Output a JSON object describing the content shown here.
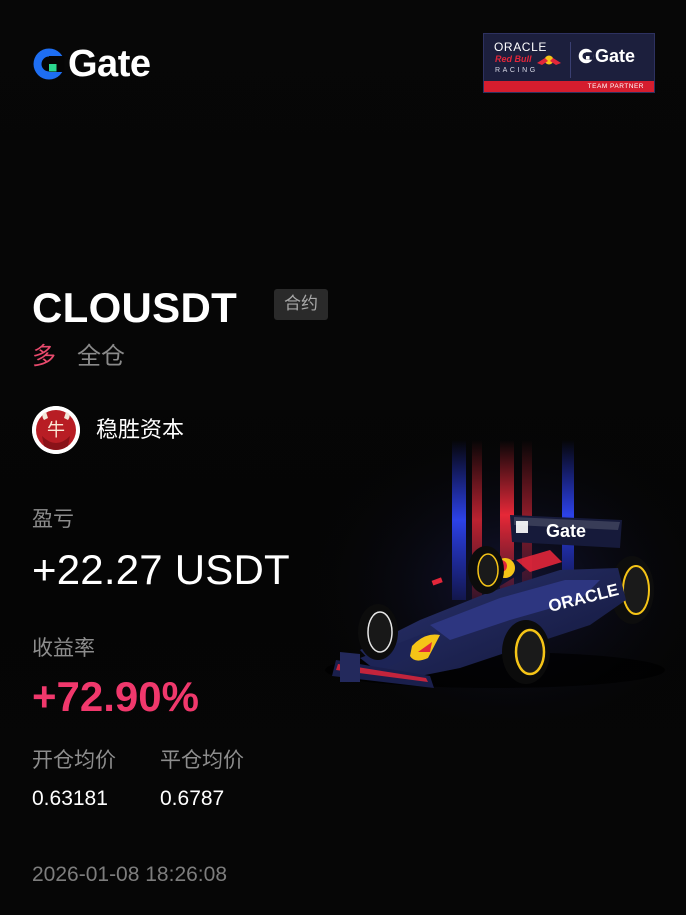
{
  "brand": {
    "logo_text": "Gate",
    "logo_icon": "gate-logo-icon",
    "accent_color": "#1e6ef2"
  },
  "partner_badge": {
    "line1": "ORACLE",
    "line2": "Red Bull",
    "line3": "RACING",
    "partner_logo_text": "Gate",
    "footer": "TEAM PARTNER",
    "bar_color": "#d51d2e"
  },
  "position": {
    "symbol": "CLOUSDT",
    "type_tag": "合约",
    "side": "多",
    "margin_mode": "全仓",
    "side_color": "#e84a6d"
  },
  "trader": {
    "name": "稳胜资本",
    "avatar_glyph": "牛"
  },
  "stats": {
    "pnl_label": "盈亏",
    "pnl_value": "+22.27 USDT",
    "roi_label": "收益率",
    "roi_value": "+72.90%",
    "roi_color": "#f0386c",
    "entry_label": "开仓均价",
    "entry_value": "0.63181",
    "exit_label": "平仓均价",
    "exit_value": "0.6787"
  },
  "timestamp": "2026-01-08 18:26:08",
  "car_graphic": {
    "wing_text": "Gate",
    "sidepod_text": "ORACLE"
  }
}
